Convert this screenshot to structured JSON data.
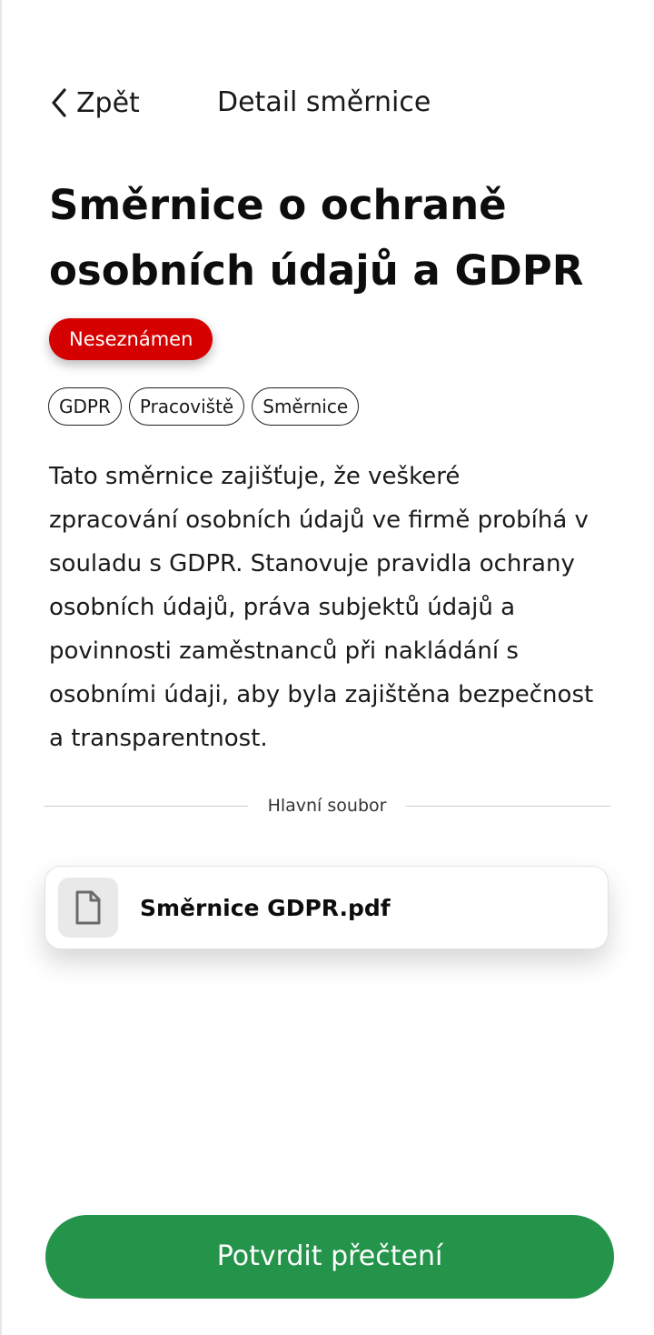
{
  "header": {
    "back_label": "Zpět",
    "title": "Detail směrnice"
  },
  "document": {
    "title": "Směrnice o ochraně osobních údajů a GDPR",
    "status": "Neseznámen",
    "tags": [
      "GDPR",
      "Pracoviště",
      "Směrnice"
    ],
    "description": "Tato směrnice zajišťuje, že veškeré zpracování osobních údajů ve firmě probíhá v souladu s GDPR. Stanovuje pravidla ochrany osobních údajů, práva subjektů údajů a povinnosti zaměstnanců při nakládání s osobními údaji, aby byla zajištěna bezpečnost a transparentnost."
  },
  "main_file": {
    "section_label": "Hlavní soubor",
    "file_name": "Směrnice GDPR.pdf",
    "icon": "file-icon"
  },
  "actions": {
    "confirm_label": "Potvrdit přečtení"
  },
  "colors": {
    "status_badge": "#d50000",
    "confirm_button": "#23944a",
    "file_icon_bg": "#e9e9e9"
  },
  "icons": {
    "back": "chevron-left-icon",
    "file": "file-icon"
  }
}
